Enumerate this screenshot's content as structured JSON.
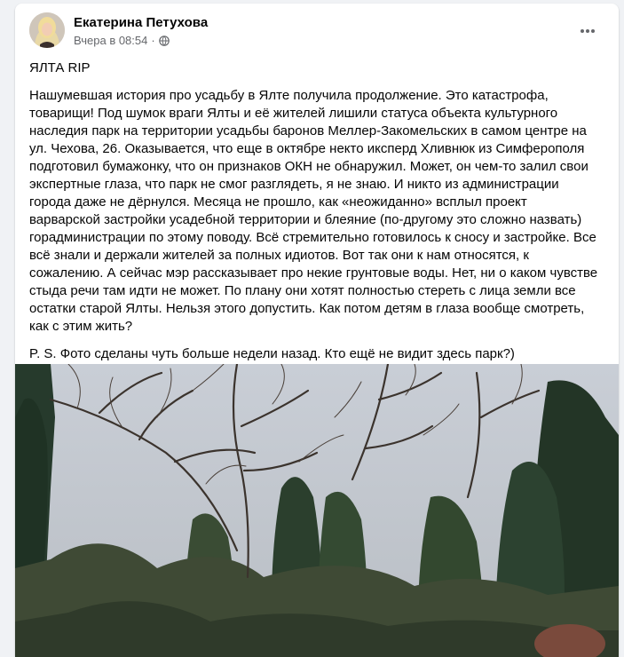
{
  "post": {
    "author": "Екатерина Петухова",
    "timestamp": "Вчера в 08:54",
    "separator": "·",
    "audience_icon": "globe-icon",
    "more_icon": "ellipsis-icon",
    "title": "ЯЛТА RIP",
    "body": "Нашумевшая история про усадьбу в Ялте получила продолжение. Это катастрофа, товарищи! Под шумок враги Ялты и её жителей лишили статуса объекта культурного наследия парк на территории усадьбы баронов Меллер-Закомельских в самом центре на ул. Чехова, 26. Оказывается, что еще в октябре некто иксперд Хливнюк из Симферополя подготовил бумажонку, что он признаков ОКН не обнаружил. Может, он чем-то залил свои экспертные глаза, что парк не смог разглядеть, я не знаю. И никто из администрации города даже не дёрнулся. Месяца не прошло, как «неожиданно» всплыл проект варварской застройки усадебной территории и блеяние (по-другому это сложно назвать) горадминистрации по этому поводу. Всё стремительно готовилось к сносу и застройке. Все всё знали и держали жителей за полных идиотов. Вот так они к нам относятся, к сожалению. А сейчас мэр рассказывает про некие грунтовые воды. Нет, ни о каком чувстве стыда речи там идти не может. По плану они хотят полностью стереть с лица земли все остатки старой Ялты. Нельзя этого допустить. Как потом детям в глаза вообще смотреть, как с этим жить?",
    "postscript": "P. S. Фото сделаны чуть больше недели назад. Кто ещё не видит здесь парк?)"
  },
  "colors": {
    "page_bg": "#f0f2f5",
    "card_bg": "#ffffff",
    "text": "#050505",
    "secondary_text": "#65676b"
  }
}
